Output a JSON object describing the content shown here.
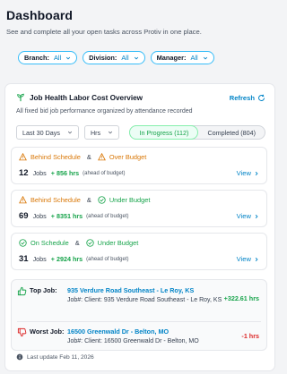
{
  "page": {
    "title": "Dashboard",
    "subtitle": "See and complete all your open tasks across Protiv in one place."
  },
  "filters": [
    {
      "label": "Branch:",
      "value": "All"
    },
    {
      "label": "Division:",
      "value": "All"
    },
    {
      "label": "Manager:",
      "value": "All"
    }
  ],
  "card": {
    "title": "Job Health Labor Cost Overview",
    "refresh_label": "Refresh",
    "description": "All fixed bid job performance organized by attendance recorded",
    "period_select": "Last 30 Days",
    "unit_select": "Hrs",
    "toggles": {
      "in_progress": "In Progress (112)",
      "completed": "Completed (804)"
    }
  },
  "stats": [
    {
      "status1": "Behind Schedule",
      "amp": "&",
      "status2": "Over Budget",
      "count": "12",
      "jobs_label": "Jobs",
      "hours": "+ 856 hrs",
      "note": "(ahead of budget)",
      "view_label": "View"
    },
    {
      "status1": "Behind Schedule",
      "amp": "&",
      "status2": "Under Budget",
      "count": "69",
      "jobs_label": "Jobs",
      "hours": "+ 8351 hrs",
      "note": "(ahead of budget)",
      "view_label": "View"
    },
    {
      "status1": "On Schedule",
      "amp": "&",
      "status2": "Under Budget",
      "count": "31",
      "jobs_label": "Jobs",
      "hours": "+ 2924 hrs",
      "note": "(ahead of budget)",
      "view_label": "View"
    }
  ],
  "top_job": {
    "label": "Top Job:",
    "name": "935 Verdure Road Southeast - Le Roy, KS",
    "detail": "Job#: Client: 935 Verdure Road Southeast - Le Roy, KS",
    "value": "+322.61 hrs"
  },
  "worst_job": {
    "label": "Worst Job:",
    "name": "16500 Greenwald Dr - Belton, MO",
    "detail": "Job#: Client: 16500 Greenwald Dr - Belton, MO",
    "value": "-1 hrs"
  },
  "last_update": "Last update Feb 11, 2026",
  "colors": {
    "accent": "#0284c7",
    "warning": "#d97706",
    "success": "#16a34a",
    "danger": "#dc2626"
  }
}
